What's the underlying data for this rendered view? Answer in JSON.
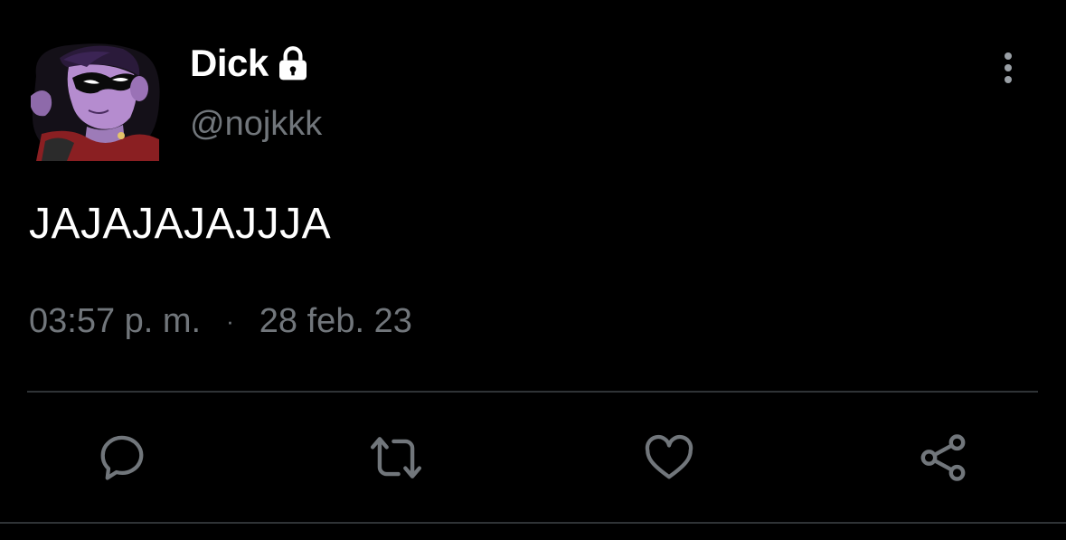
{
  "tweet": {
    "author": {
      "display_name": "Dick",
      "handle": "@nojkkk",
      "protected_icon": "lock-icon",
      "avatar_icon": "avatar-image"
    },
    "text": "JAJAJAJAJJJA",
    "time": "03:57 p. m.",
    "separator": "·",
    "date": "28 feb. 23",
    "more_icon": "more-vertical-icon"
  },
  "actions": [
    {
      "name": "reply",
      "icon": "comment-icon"
    },
    {
      "name": "retweet",
      "icon": "retweet-icon"
    },
    {
      "name": "like",
      "icon": "heart-icon"
    },
    {
      "name": "share",
      "icon": "share-icon"
    }
  ],
  "colors": {
    "background": "#000000",
    "primary_text": "#ffffff",
    "secondary_text": "#71767b",
    "divider": "#2f3336"
  }
}
